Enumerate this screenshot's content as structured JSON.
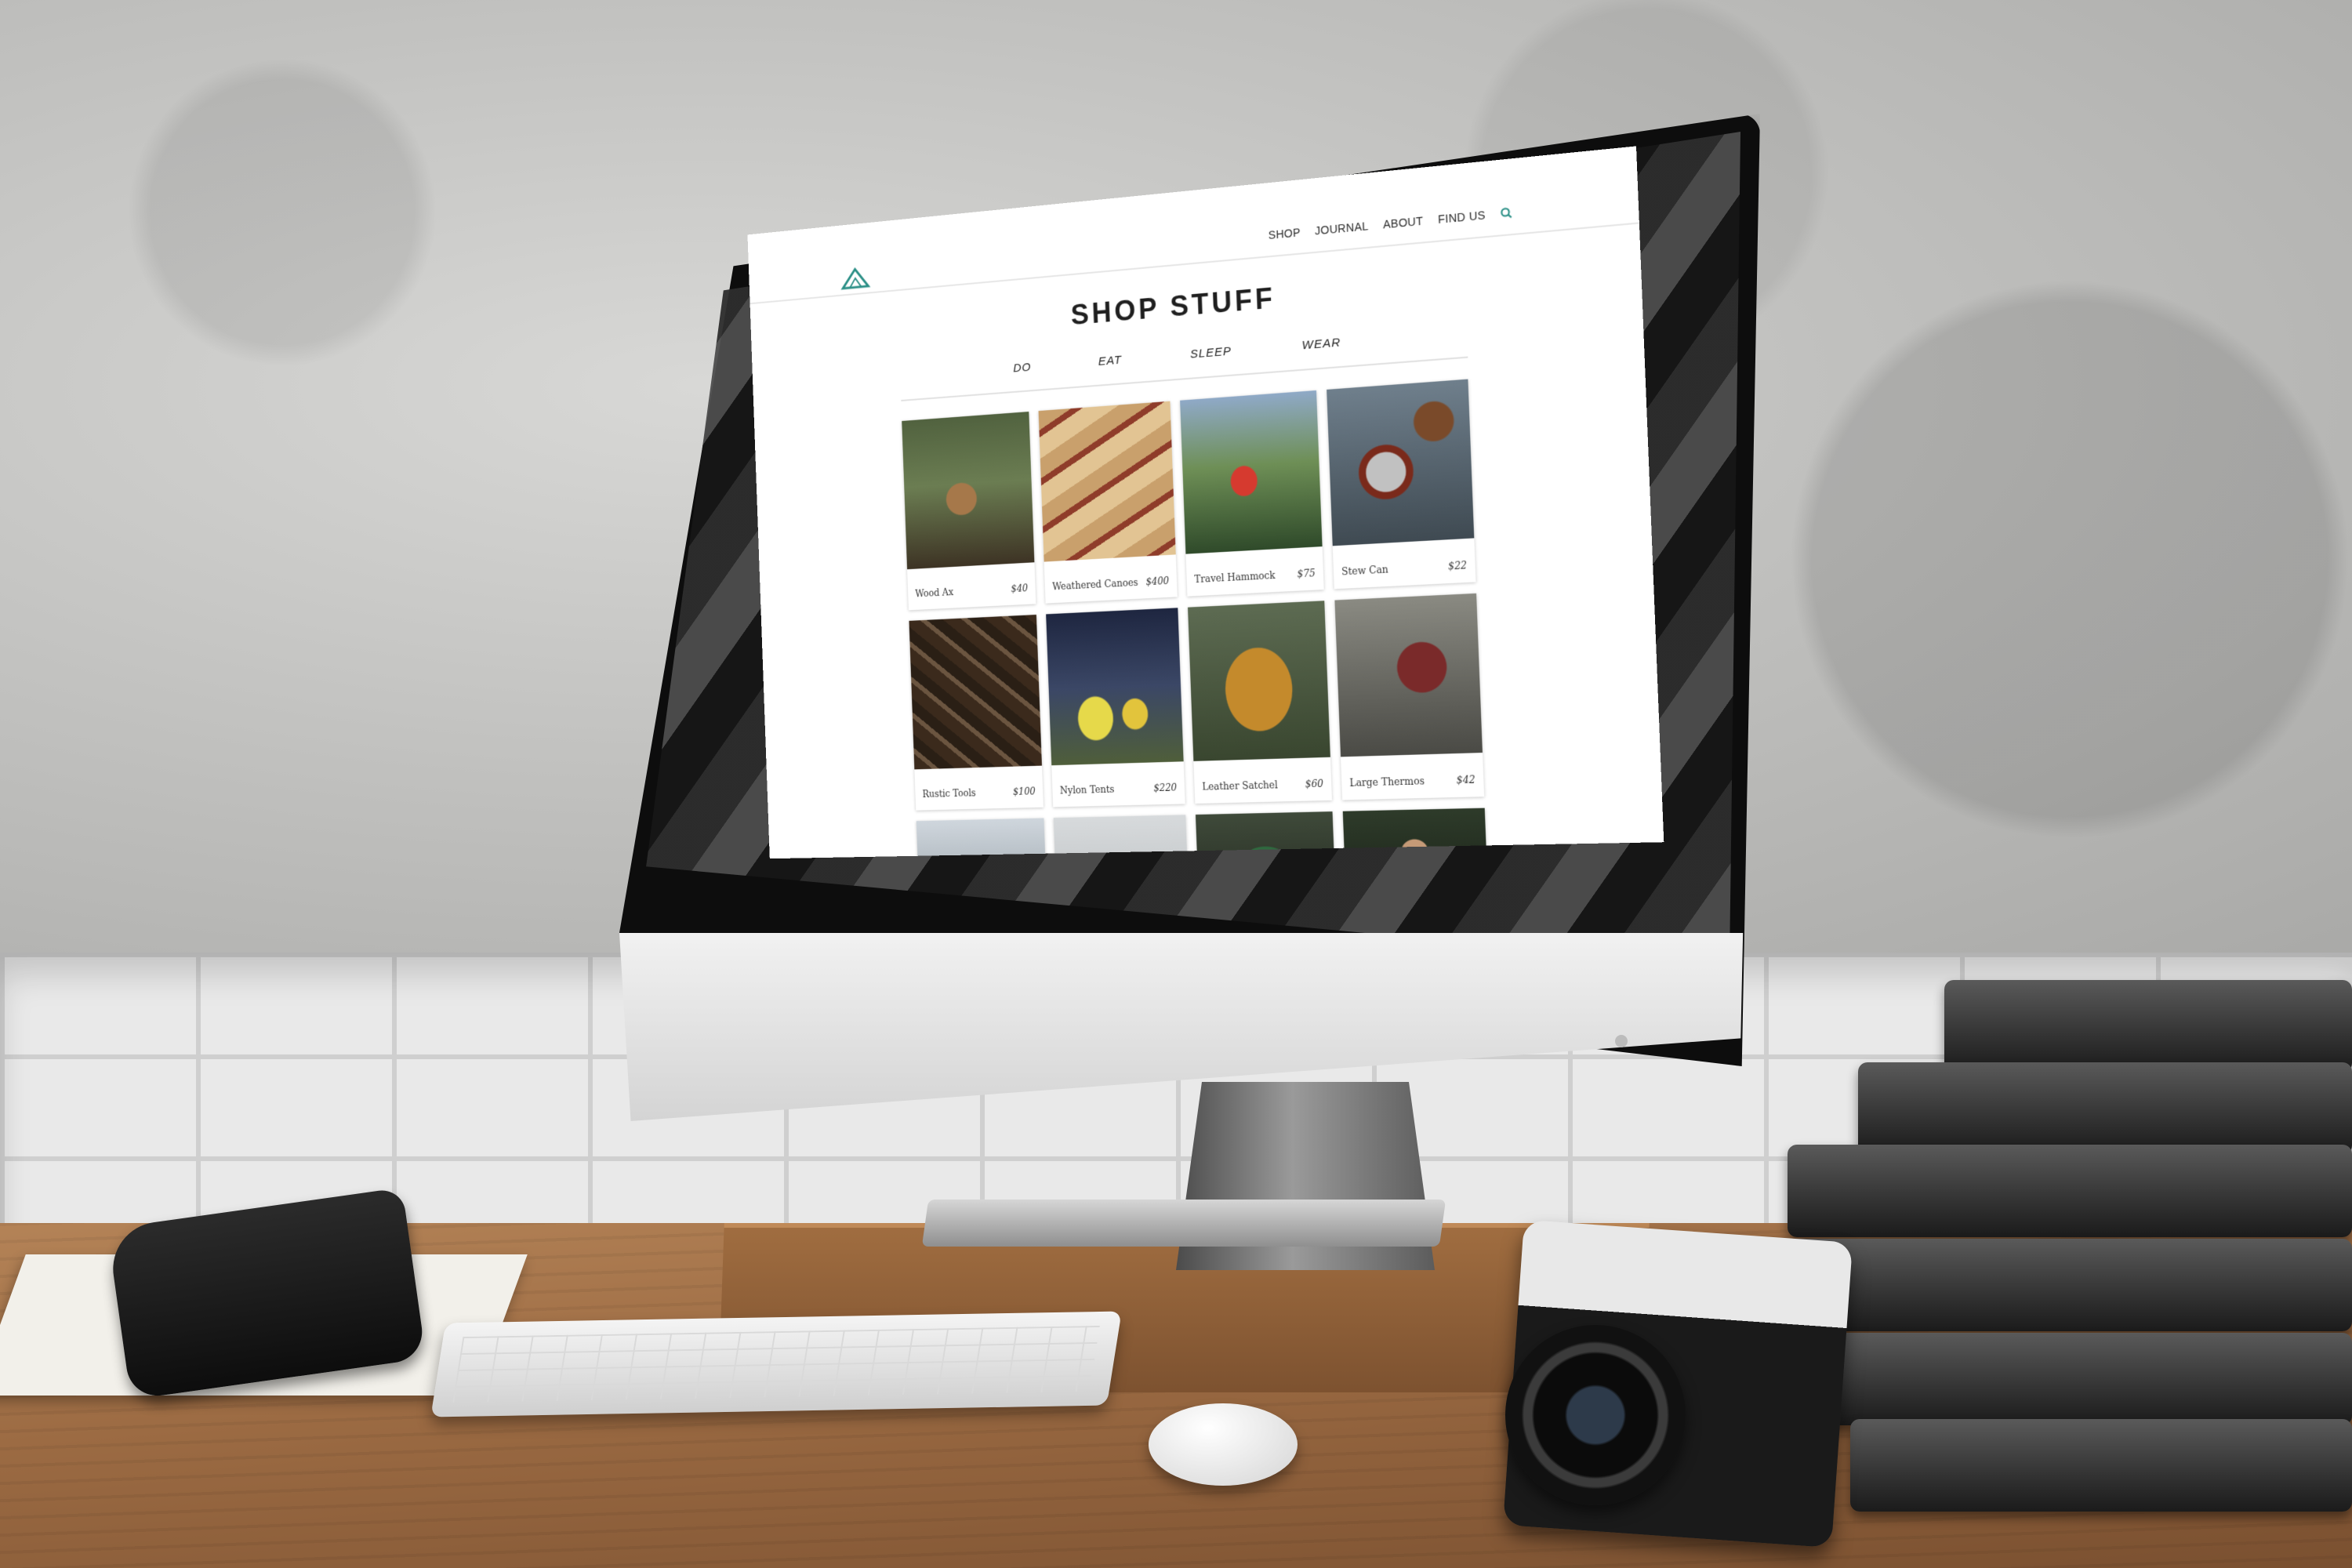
{
  "site": {
    "nav": [
      "SHOP",
      "JOURNAL",
      "ABOUT",
      "FIND US"
    ],
    "search_icon": "search-icon",
    "logo_icon": "tent-logo-icon",
    "accent_color": "#2a8f86",
    "title": "SHOP STUFF",
    "categories": [
      "DO",
      "EAT",
      "SLEEP",
      "WEAR"
    ]
  },
  "products": [
    {
      "name": "Wood Ax",
      "price": "$40"
    },
    {
      "name": "Weathered Canoes",
      "price": "$400"
    },
    {
      "name": "Travel Hammock",
      "price": "$75"
    },
    {
      "name": "Stew Can",
      "price": "$22"
    },
    {
      "name": "Rustic Tools",
      "price": "$100"
    },
    {
      "name": "Nylon Tents",
      "price": "$220"
    },
    {
      "name": "Leather Satchel",
      "price": "$60"
    },
    {
      "name": "Large Thermos",
      "price": "$42"
    }
  ]
}
